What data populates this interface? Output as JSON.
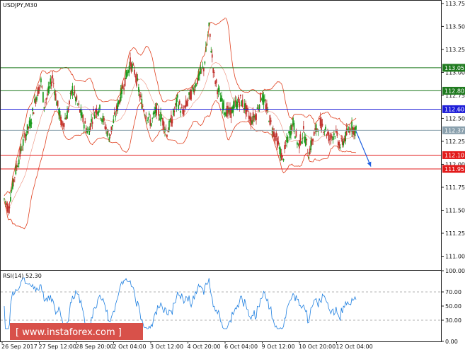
{
  "chart_data": [
    {
      "type": "candlestick",
      "title": "USDJPY,M30",
      "ylim": [
        110.85,
        113.78
      ],
      "y_ticks": [
        "113.75",
        "113.50",
        "113.25",
        "113.00",
        "112.75",
        "112.50",
        "112.25",
        "112.00",
        "111.75",
        "111.50",
        "111.25",
        "111.00"
      ],
      "x_ticks": [
        "26 Sep 2017",
        "27 Sep 12:00",
        "28 Sep 20:00",
        "2 Oct 04:00",
        "3 Oct 12:00",
        "4 Oct 20:00",
        "6 Oct 04:00",
        "9 Oct 12:00",
        "10 Oct 20:00",
        "12 Oct 04:00"
      ],
      "levels": [
        {
          "label": "113.05",
          "value": 113.05,
          "color": "#1f7a1f"
        },
        {
          "label": "112.80",
          "value": 112.8,
          "color": "#1f7a1f"
        },
        {
          "label": "112.60",
          "value": 112.6,
          "color": "#1e1ed8"
        },
        {
          "label": "112.37",
          "value": 112.37,
          "color": "#8aa0ad"
        },
        {
          "label": "112.10",
          "value": 112.1,
          "color": "#e21b1b"
        },
        {
          "label": "111.95",
          "value": 111.95,
          "color": "#e21b1b"
        }
      ],
      "price_path": [
        [
          0,
          111.62
        ],
        [
          4,
          111.52
        ],
        [
          8,
          111.78
        ],
        [
          12,
          111.98
        ],
        [
          16,
          112.15
        ],
        [
          20,
          112.32
        ],
        [
          25,
          112.45
        ],
        [
          30,
          112.72
        ],
        [
          35,
          112.9
        ],
        [
          38,
          112.65
        ],
        [
          42,
          112.78
        ],
        [
          46,
          112.95
        ],
        [
          50,
          112.68
        ],
        [
          55,
          112.42
        ],
        [
          60,
          112.55
        ],
        [
          65,
          112.82
        ],
        [
          70,
          112.65
        ],
        [
          75,
          112.48
        ],
        [
          80,
          112.35
        ],
        [
          85,
          112.55
        ],
        [
          90,
          112.62
        ],
        [
          95,
          112.45
        ],
        [
          100,
          112.3
        ],
        [
          105,
          112.5
        ],
        [
          110,
          112.72
        ],
        [
          115,
          112.92
        ],
        [
          120,
          113.1
        ],
        [
          125,
          112.98
        ],
        [
          130,
          112.7
        ],
        [
          135,
          112.55
        ],
        [
          140,
          112.45
        ],
        [
          145,
          112.6
        ],
        [
          150,
          112.5
        ],
        [
          155,
          112.35
        ],
        [
          160,
          112.5
        ],
        [
          165,
          112.7
        ],
        [
          170,
          112.55
        ],
        [
          175,
          112.7
        ],
        [
          180,
          112.82
        ],
        [
          185,
          112.95
        ],
        [
          190,
          113.05
        ],
        [
          195,
          113.48
        ],
        [
          200,
          112.95
        ],
        [
          205,
          112.75
        ],
        [
          210,
          112.6
        ],
        [
          215,
          112.55
        ],
        [
          220,
          112.65
        ],
        [
          225,
          112.7
        ],
        [
          230,
          112.6
        ],
        [
          235,
          112.48
        ],
        [
          240,
          112.55
        ],
        [
          245,
          112.75
        ],
        [
          250,
          112.6
        ],
        [
          255,
          112.4
        ],
        [
          260,
          112.25
        ],
        [
          265,
          112.05
        ],
        [
          270,
          112.28
        ],
        [
          275,
          112.45
        ],
        [
          280,
          112.2
        ],
        [
          285,
          112.35
        ],
        [
          290,
          112.12
        ],
        [
          295,
          112.32
        ],
        [
          300,
          112.45
        ],
        [
          305,
          112.4
        ],
        [
          310,
          112.28
        ],
        [
          315,
          112.35
        ],
        [
          320,
          112.2
        ],
        [
          325,
          112.3
        ],
        [
          330,
          112.42
        ],
        [
          335,
          112.36
        ]
      ],
      "forecast_path": [
        [
          335,
          112.36
        ],
        [
          360,
          111.96
        ]
      ]
    },
    {
      "type": "line",
      "title": "RSI(14) 52.30",
      "ylim": [
        0,
        100
      ],
      "y_ticks": [
        "100.00",
        "70.00",
        "50.00",
        "30.00",
        "0.00"
      ],
      "levels": [
        70,
        30
      ]
    }
  ],
  "watermark": "[ www.instaforex.com ]",
  "colors": {
    "bull": "#1a9a1a",
    "bear": "#c0322d",
    "band": "#e0401f",
    "rsi": "#1e7fe0",
    "forecast": "#1e5fe0"
  }
}
